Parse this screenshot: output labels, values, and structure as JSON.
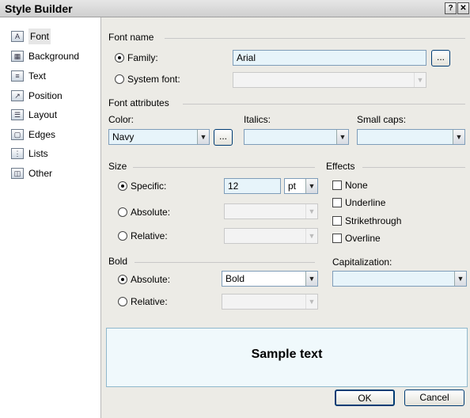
{
  "window": {
    "title": "Style Builder",
    "help_glyph": "?",
    "close_glyph": "✕"
  },
  "sidebar": {
    "items": [
      {
        "label": "Font",
        "icon": "font-icon"
      },
      {
        "label": "Background",
        "icon": "background-icon"
      },
      {
        "label": "Text",
        "icon": "text-icon"
      },
      {
        "label": "Position",
        "icon": "position-icon"
      },
      {
        "label": "Layout",
        "icon": "layout-icon"
      },
      {
        "label": "Edges",
        "icon": "edges-icon"
      },
      {
        "label": "Lists",
        "icon": "lists-icon"
      },
      {
        "label": "Other",
        "icon": "other-icon"
      }
    ]
  },
  "font_name": {
    "group_label": "Font name",
    "family_label": "Family:",
    "family_value": "Arial",
    "browse_label": "...",
    "system_font_label": "System font:"
  },
  "font_attributes": {
    "group_label": "Font attributes",
    "color_label": "Color:",
    "color_value": "Navy",
    "color_browse": "...",
    "italics_label": "Italics:",
    "small_caps_label": "Small caps:"
  },
  "size": {
    "group_label": "Size",
    "specific_label": "Specific:",
    "specific_value": "12",
    "unit_value": "pt",
    "absolute_label": "Absolute:",
    "relative_label": "Relative:"
  },
  "effects": {
    "group_label": "Effects",
    "none_label": "None",
    "underline_label": "Underline",
    "strikethrough_label": "Strikethrough",
    "overline_label": "Overline"
  },
  "bold": {
    "group_label": "Bold",
    "absolute_label": "Absolute:",
    "absolute_value": "Bold",
    "relative_label": "Relative:"
  },
  "capitalization": {
    "label": "Capitalization:"
  },
  "sample": {
    "text": "Sample text"
  },
  "buttons": {
    "ok": "OK",
    "cancel": "Cancel"
  },
  "arrow_glyph": "▼"
}
